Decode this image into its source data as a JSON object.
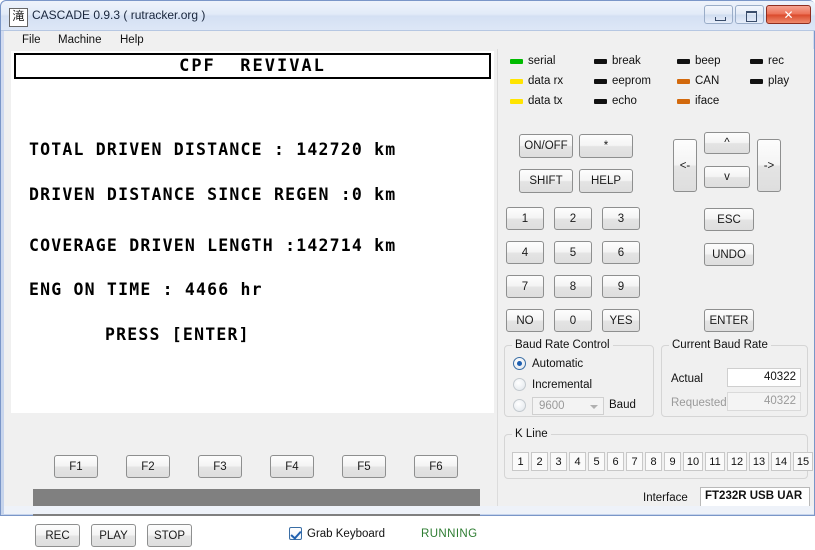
{
  "window": {
    "app_icon_glyph": "滝",
    "title": "CASCADE 0.9.3 ( rutracker.org )",
    "minimize_label": "",
    "maximize_label": "",
    "close_label": "✕"
  },
  "menu": {
    "items": [
      {
        "label": "File"
      },
      {
        "label": "Machine"
      },
      {
        "label": "Help"
      }
    ]
  },
  "display": {
    "header": "CPF  REVIVAL",
    "lines": [
      {
        "text": "TOTAL DRIVEN DISTANCE : 142720 km"
      },
      {
        "text": "DRIVEN DISTANCE SINCE REGEN :0 km"
      },
      {
        "text": "COVERAGE DRIVEN LENGTH :142714 km"
      },
      {
        "text": "ENG ON TIME : 4466 hr"
      },
      {
        "text": "PRESS [ENTER]"
      }
    ]
  },
  "function_keys": [
    {
      "label": "F1"
    },
    {
      "label": "F2"
    },
    {
      "label": "F3"
    },
    {
      "label": "F4"
    },
    {
      "label": "F5"
    },
    {
      "label": "F6"
    }
  ],
  "transport": {
    "rec_label": "REC",
    "play_label": "PLAY",
    "stop_label": "STOP",
    "grab_keyboard_label": "Grab Keyboard",
    "grab_keyboard_checked": true,
    "status_text": "RUNNING",
    "status_color": "#2e7d32"
  },
  "leds": [
    {
      "label": "serial",
      "color": "#00bb00"
    },
    {
      "label": "break",
      "color": "#111111"
    },
    {
      "label": "beep",
      "color": "#111111"
    },
    {
      "label": "rec",
      "color": "#111111"
    },
    {
      "label": "data rx",
      "color": "#ffe400"
    },
    {
      "label": "eeprom",
      "color": "#111111"
    },
    {
      "label": "CAN",
      "color": "#d2690d"
    },
    {
      "label": "play",
      "color": "#111111"
    },
    {
      "label": "data tx",
      "color": "#ffe400"
    },
    {
      "label": "echo",
      "color": "#111111"
    },
    {
      "label": "iface",
      "color": "#d2690d"
    }
  ],
  "keypad": {
    "onoff_label": "ON/OFF",
    "star_label": "*",
    "shift_label": "SHIFT",
    "help_label": "HELP",
    "digits": [
      {
        "label": "1"
      },
      {
        "label": "2"
      },
      {
        "label": "3"
      },
      {
        "label": "4"
      },
      {
        "label": "5"
      },
      {
        "label": "6"
      },
      {
        "label": "7"
      },
      {
        "label": "8"
      },
      {
        "label": "9"
      },
      {
        "label": "NO"
      },
      {
        "label": "0"
      },
      {
        "label": "YES"
      }
    ],
    "left_label": "<-",
    "right_label": "->",
    "up_label": "^",
    "down_label": "v",
    "esc_label": "ESC",
    "undo_label": "UNDO",
    "enter_label": "ENTER"
  },
  "baud_control": {
    "group_title": "Baud Rate Control",
    "automatic_label": "Automatic",
    "incremental_label": "Incremental",
    "manual_value": "9600",
    "manual_unit_label": "Baud",
    "selected": "Automatic"
  },
  "current_baud": {
    "group_title": "Current Baud Rate",
    "actual_label": "Actual",
    "actual_value": "40322",
    "requested_label": "Requested",
    "requested_value": "40322"
  },
  "kline": {
    "group_title": "K Line",
    "buttons": [
      {
        "label": "1"
      },
      {
        "label": "2"
      },
      {
        "label": "3"
      },
      {
        "label": "4"
      },
      {
        "label": "5"
      },
      {
        "label": "6"
      },
      {
        "label": "7"
      },
      {
        "label": "8"
      },
      {
        "label": "9"
      },
      {
        "label": "10"
      },
      {
        "label": "11"
      },
      {
        "label": "12"
      },
      {
        "label": "13"
      },
      {
        "label": "14"
      },
      {
        "label": "15"
      }
    ]
  },
  "interface": {
    "label": "Interface",
    "value": "FT232R USB UAR"
  }
}
